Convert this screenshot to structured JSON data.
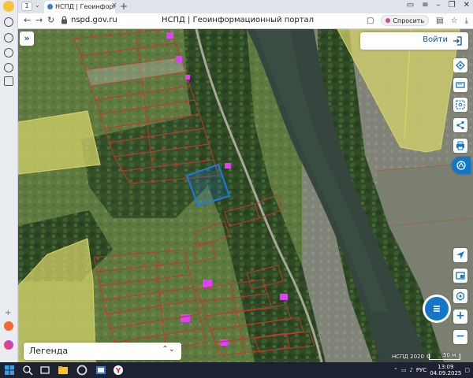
{
  "browser": {
    "tab_count": "1",
    "tab_title": "НСПД | Геоинформаци",
    "domain": "nspd.gov.ru",
    "page_title": "НСПД | Геоинформационный портал",
    "ask_label": "Спросить",
    "download_icon": "download-icon",
    "sidebar_icons": [
      "user-icon",
      "clock-icon",
      "mail-icon",
      "video-icon",
      "chat-icon",
      "image-icon"
    ],
    "sidebar_bottom_badge": "Yandex"
  },
  "map": {
    "expand_label": "»",
    "login_label": "Войти",
    "legend_label": "Легенда",
    "attribution": "НСПД 2020 ©",
    "scale_label": "50 м",
    "colors": {
      "parcel_border": "#c0392b",
      "zone_yellow": "#d7d56a",
      "building": "#e040fb",
      "selected": "#1f7ae0",
      "accent": "#1476c9"
    },
    "tools_top": [
      "layers-icon",
      "ruler-icon",
      "select-icon",
      "share-icon",
      "print-icon",
      "search-panel-icon"
    ],
    "tools_bottom": [
      "geolocate-icon",
      "image-icon",
      "compass-icon"
    ],
    "zoom_in": "+",
    "zoom_out": "−"
  },
  "taskbar": {
    "lang": "РУС",
    "time": "13:09",
    "date": "04.09.2025"
  }
}
